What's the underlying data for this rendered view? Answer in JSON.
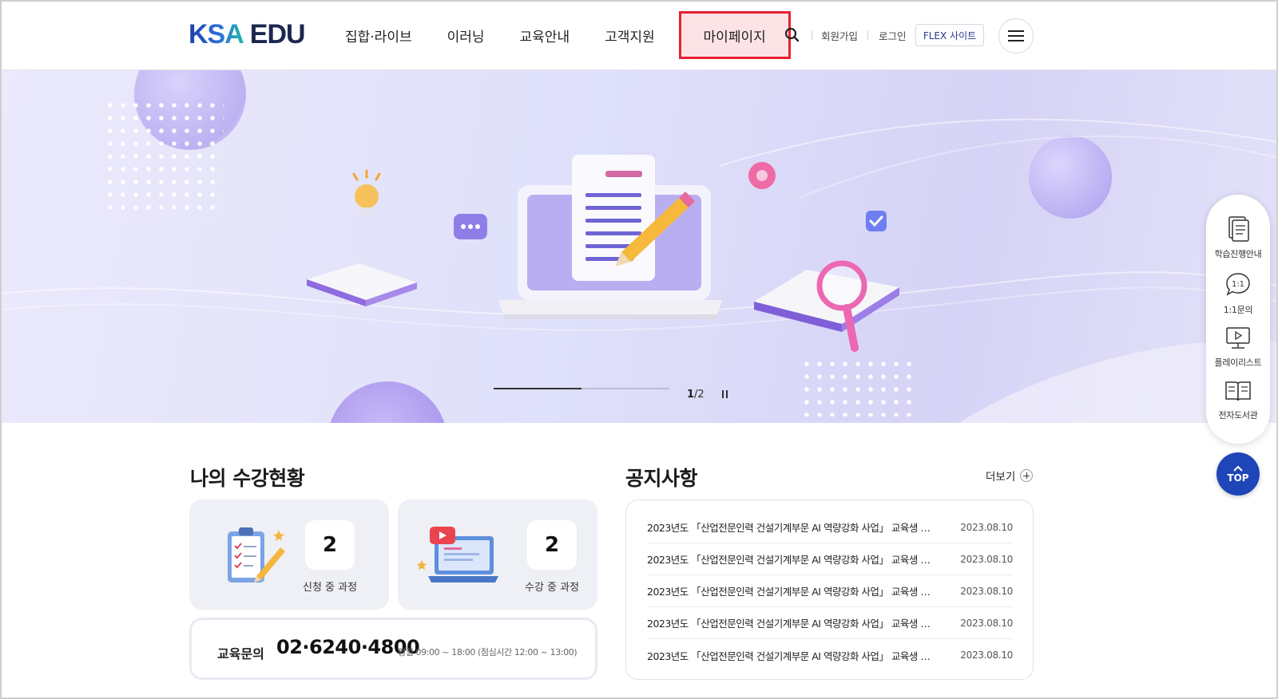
{
  "header": {
    "logo_primary": "KSA",
    "logo_secondary": "EDU",
    "nav": [
      {
        "label": "집합·라이브"
      },
      {
        "label": "이러닝"
      },
      {
        "label": "교육안내"
      },
      {
        "label": "고객지원"
      },
      {
        "label": "마이페이지",
        "highlighted": true
      }
    ],
    "search_icon": "search-icon",
    "utility_links": [
      "회원가입",
      "로그인"
    ],
    "flex_button": "FLEX 사이트",
    "menu_icon": "hamburger-menu-icon"
  },
  "banner": {
    "current_slide": "1",
    "total_slides": "/2",
    "progress_fraction": 0.5,
    "pause_icon": "pause-icon"
  },
  "quick_menu": [
    {
      "label": "학습진행안내",
      "icon": "document-icon"
    },
    {
      "label": "1:1문의",
      "icon": "chat-bubble-icon",
      "icon_text": "1:1"
    },
    {
      "label": "플레이리스트",
      "icon": "monitor-play-icon"
    },
    {
      "label": "전자도서관",
      "icon": "open-book-icon"
    }
  ],
  "top_button": "TOP",
  "my_courses": {
    "title": "나의 수강현황",
    "cards": [
      {
        "count": "2",
        "label": "신청 중 과정",
        "icon": "clipboard-icon"
      },
      {
        "count": "2",
        "label": "수강 중 과정",
        "icon": "laptop-play-icon"
      }
    ]
  },
  "contact": {
    "label": "교육문의",
    "phone": "02·6240·4800",
    "hours": "평일 09:00 ~ 18:00 (점심시간 12:00 ~ 13:00)"
  },
  "notice": {
    "title": "공지사항",
    "more_label": "더보기",
    "items": [
      {
        "title": "2023년도 「산업전문인력 건설기계부문 AI 역량강화 사업」 교육생 …",
        "date": "2023.08.10"
      },
      {
        "title": "2023년도 「산업전문인력 건설기계부문 AI 역량강화 사업」 교육생 …",
        "date": "2023.08.10"
      },
      {
        "title": "2023년도 「산업전문인력 건설기계부문 AI 역량강화 사업」 교육생 …",
        "date": "2023.08.10"
      },
      {
        "title": "2023년도 「산업전문인력 건설기계부문 AI 역량강화 사업」 교육생 …",
        "date": "2023.08.10"
      },
      {
        "title": "2023년도 「산업전문인력 건설기계부문 AI 역량강화 사업」 교육생 …",
        "date": "2023.08.10"
      }
    ]
  },
  "colors": {
    "accent_blue": "#1f46b8",
    "highlight_border": "#e8202f",
    "highlight_fill": "#fbe3e6"
  }
}
